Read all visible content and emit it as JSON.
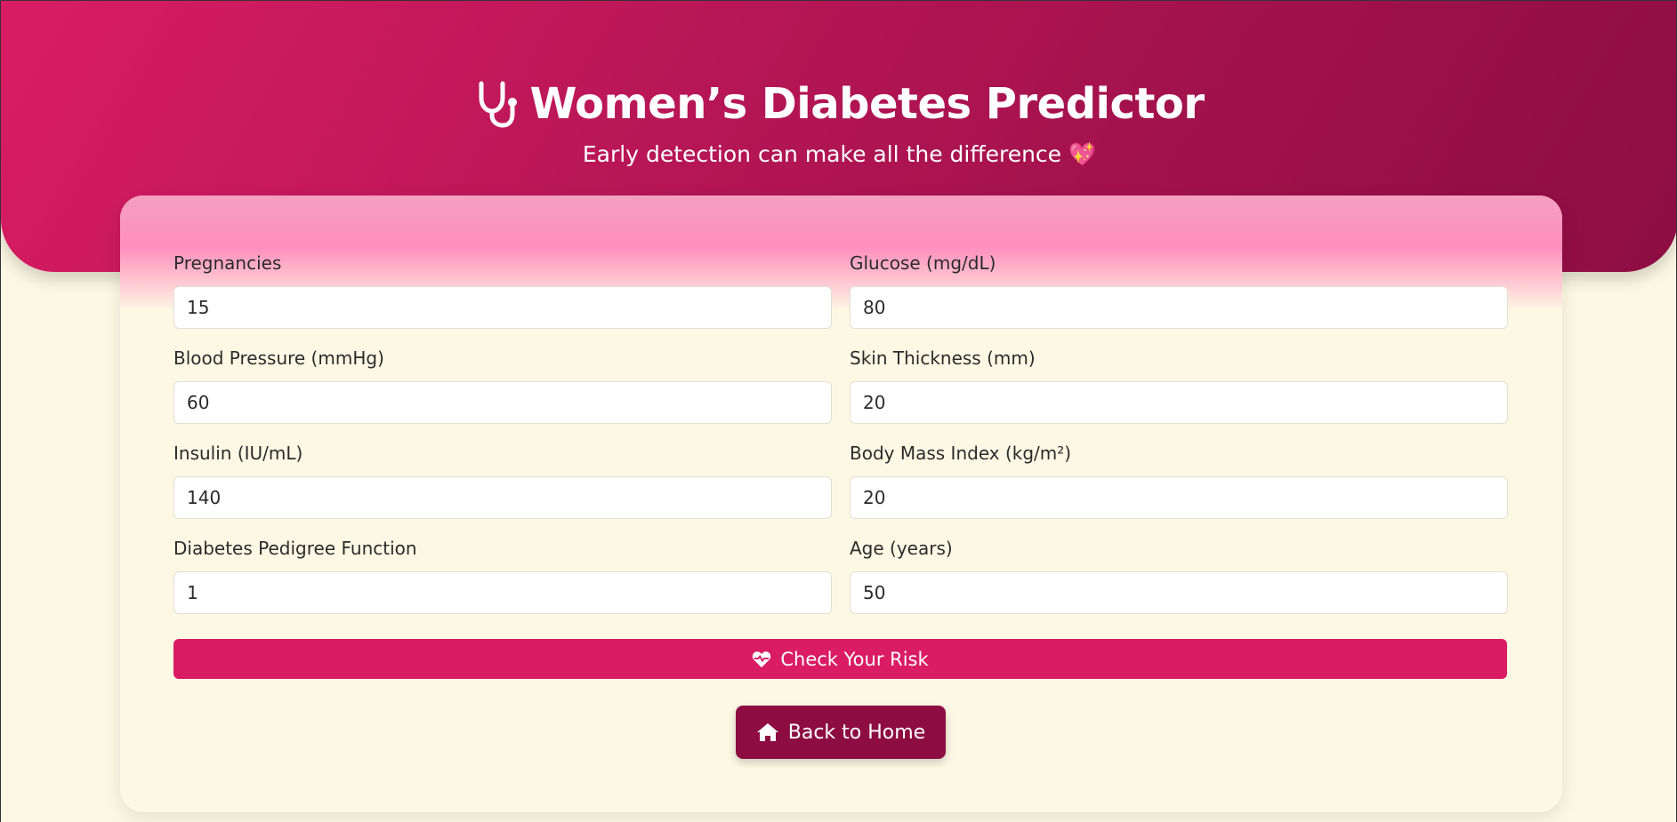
{
  "header": {
    "title": "Women’s Diabetes Predictor",
    "subtitle": "Early detection can make all the difference 💖",
    "icon": "stethoscope-icon"
  },
  "form": {
    "fields": [
      {
        "label": "Pregnancies",
        "value": "15"
      },
      {
        "label": "Glucose (mg/dL)",
        "value": "80"
      },
      {
        "label": "Blood Pressure (mmHg)",
        "value": "60"
      },
      {
        "label": "Skin Thickness (mm)",
        "value": "20"
      },
      {
        "label": "Insulin (IU/mL)",
        "value": "140"
      },
      {
        "label": "Body Mass Index (kg/m²)",
        "value": "20"
      },
      {
        "label": "Diabetes Pedigree Function",
        "value": "1"
      },
      {
        "label": "Age (years)",
        "value": "50"
      }
    ],
    "submit_label": "Check Your Risk",
    "submit_icon": "heart-pulse-icon"
  },
  "nav": {
    "home_label": "Back to Home",
    "home_icon": "home-icon"
  },
  "colors": {
    "primary": "#d91c63",
    "dark": "#8d0d42",
    "background": "#fdf8e4"
  }
}
